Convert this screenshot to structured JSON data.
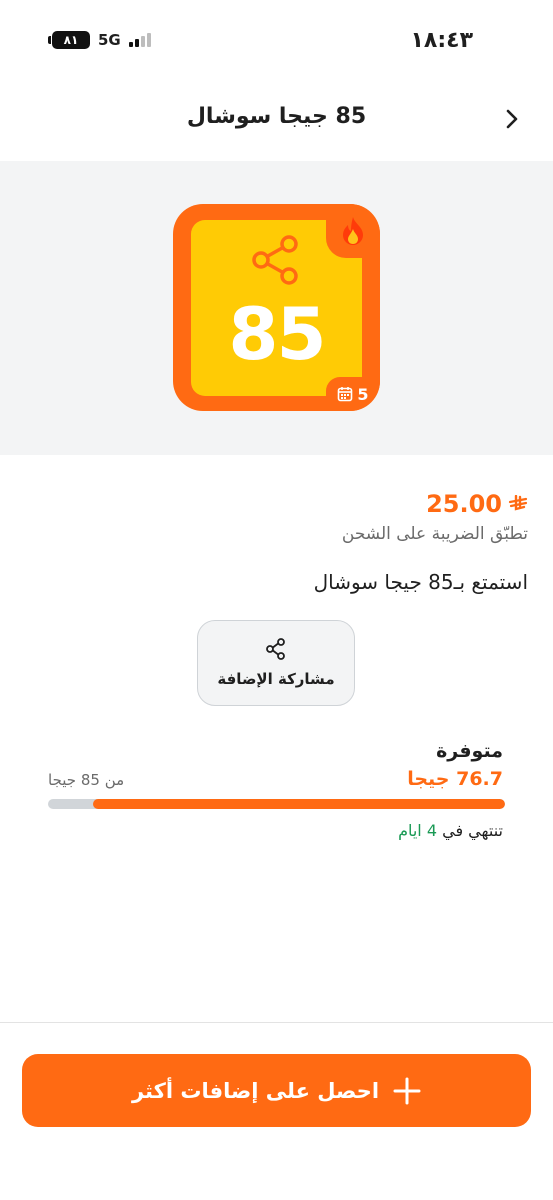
{
  "status_bar": {
    "time": "١٨:٤٣",
    "battery": "٨١",
    "network": "5G",
    "icons": [
      "battery-icon",
      "signal-icon"
    ]
  },
  "header": {
    "title": "85 جيجا سوشال",
    "back_icon": "chevron-right-icon"
  },
  "hero": {
    "number": "85",
    "days": "5",
    "icons": [
      "share-icon",
      "flame-icon",
      "calendar-icon"
    ],
    "colors": {
      "tile": "#ff6a13",
      "inner": "#ffcb05",
      "background": "#f3f4f5"
    }
  },
  "details": {
    "price": "25.00",
    "currency_icon": "riyal-symbol-icon",
    "tax_note": "تطبّق الضريبة على الشحن",
    "enjoy": "استمتع بـ85 جيجا سوشال"
  },
  "share_button": {
    "label": "مشاركة الإضافة",
    "icon": "share-icon"
  },
  "usage": {
    "available_label": "متوفرة",
    "remaining": "76.7 جيجا",
    "total": "من 85 جيجا",
    "remaining_fraction": 0.902,
    "expires_prefix": "تنتهي في",
    "expires_days": "4 ايام"
  },
  "cta": {
    "label": "احصل على إضافات أكثر",
    "icon": "plus-icon"
  },
  "colors": {
    "accent": "#ff6a13",
    "highlight": "#1a9a55",
    "muted": "#6b6b6b"
  }
}
